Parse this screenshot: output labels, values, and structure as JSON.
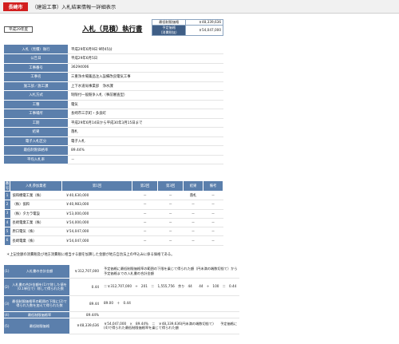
{
  "header": {
    "city": "長崎市",
    "title": "（建設工事）入札結果情報一詳細表示"
  },
  "year_label": "平成29年度",
  "doc_title": "入札（見積）執行書",
  "price_box": {
    "min_label": "最低制限価格",
    "min_value": "￥48,339,636",
    "planned_label_1": "予定価格",
    "planned_label_2": "（消費税抜）",
    "planned_value": "￥54,047,000"
  },
  "info": [
    {
      "label": "入札（見積）執行",
      "value": "平成29年6月9日 9時45分"
    },
    {
      "label": "公告日",
      "value": "平成29年6月5日"
    },
    {
      "label": "工事番号",
      "value": "36294006"
    },
    {
      "label": "工事名",
      "value": "三重浄水場薬品注入設備改良電気工事"
    },
    {
      "label": "施工部／施工課",
      "value": "上下水道局事業部　浄水課"
    },
    {
      "label": "入札方式",
      "value": "制限付一般競争入札（事前審査型）"
    },
    {
      "label": "工種",
      "value": "電気"
    },
    {
      "label": "工事場所",
      "value": "長崎市三京町・多良町"
    },
    {
      "label": "工期",
      "value": "平成29年6月14日から平成30年3月15日まで"
    },
    {
      "label": "結果",
      "value": "落札"
    },
    {
      "label": "電子入札区分",
      "value": "電子入札"
    },
    {
      "label": "最低制限価格率",
      "value": "89.44%"
    },
    {
      "label": "平均入札率",
      "value": "－"
    }
  ],
  "bids": {
    "headers": [
      "番号",
      "入札参加業者",
      "第1回",
      "第2回",
      "第3回",
      "結果",
      "備考"
    ],
    "rows": [
      {
        "no": "1",
        "company": "協和機電工業（株）",
        "r1": "￥40,630,000",
        "r2": "－",
        "r3": "－",
        "result": "落札",
        "note": "－"
      },
      {
        "no": "2",
        "company": "（株）協和",
        "r1": "￥40,983,000",
        "r2": "－",
        "r3": "－",
        "result": "－",
        "note": "－"
      },
      {
        "no": "3",
        "company": "（株）タカラ電設",
        "r1": "￥53,000,000",
        "r2": "－",
        "r3": "－",
        "result": "－",
        "note": "－"
      },
      {
        "no": "4",
        "company": "長崎電業工業（株）",
        "r1": "￥54,000,000",
        "r2": "－",
        "r3": "－",
        "result": "－",
        "note": "－"
      },
      {
        "no": "5",
        "company": "原口電気（株）",
        "r1": "￥54,047,000",
        "r2": "－",
        "r3": "－",
        "result": "－",
        "note": "－"
      },
      {
        "no": "6",
        "company": "長崎電業（株）",
        "r1": "￥54,047,000",
        "r2": "－",
        "r3": "－",
        "result": "－",
        "note": "－"
      }
    ]
  },
  "note": "＊上記金額の消費税及び地方消費税に相当する額を加算した金額が地方自治法上の申込みに係る価格である。",
  "calc": [
    {
      "no": "(1)",
      "label": "入札書の合計金額",
      "value": "￥312,707,000",
      "desc": "予定価格に最低制限価格率の範囲の下限を乗じて得られた額（円未満の端数切捨て）から予定価格までの入札書の合計金額"
    },
    {
      "no": "(2)",
      "label": "入札書の合計金額を(1)で除した値を（0.1単位で）除して得られた数",
      "value": "0.44",
      "desc": "＝￥312,707,000　÷　201　＝　1,555,756　余り　44　　44　÷　100　＝　0.44"
    },
    {
      "no": "(3)",
      "label": "最低制限価格率の範囲の下限に(2)で得られた数を加えて得られた数",
      "value": "89.44",
      "desc": "89.00　＋　0.44"
    },
    {
      "no": "(4)",
      "label": "最低制限価格率",
      "value": "89.44%",
      "desc": ""
    },
    {
      "no": "(5)",
      "label": "最低制限価格",
      "value": "￥48,339,636",
      "desc": "￥54,047,000　×　89.44%　＝　￥48,339,636(円未満の端数切捨て)　　予定価格に(4)で得られた最低制限価格率を乗じて得られた額"
    }
  ]
}
